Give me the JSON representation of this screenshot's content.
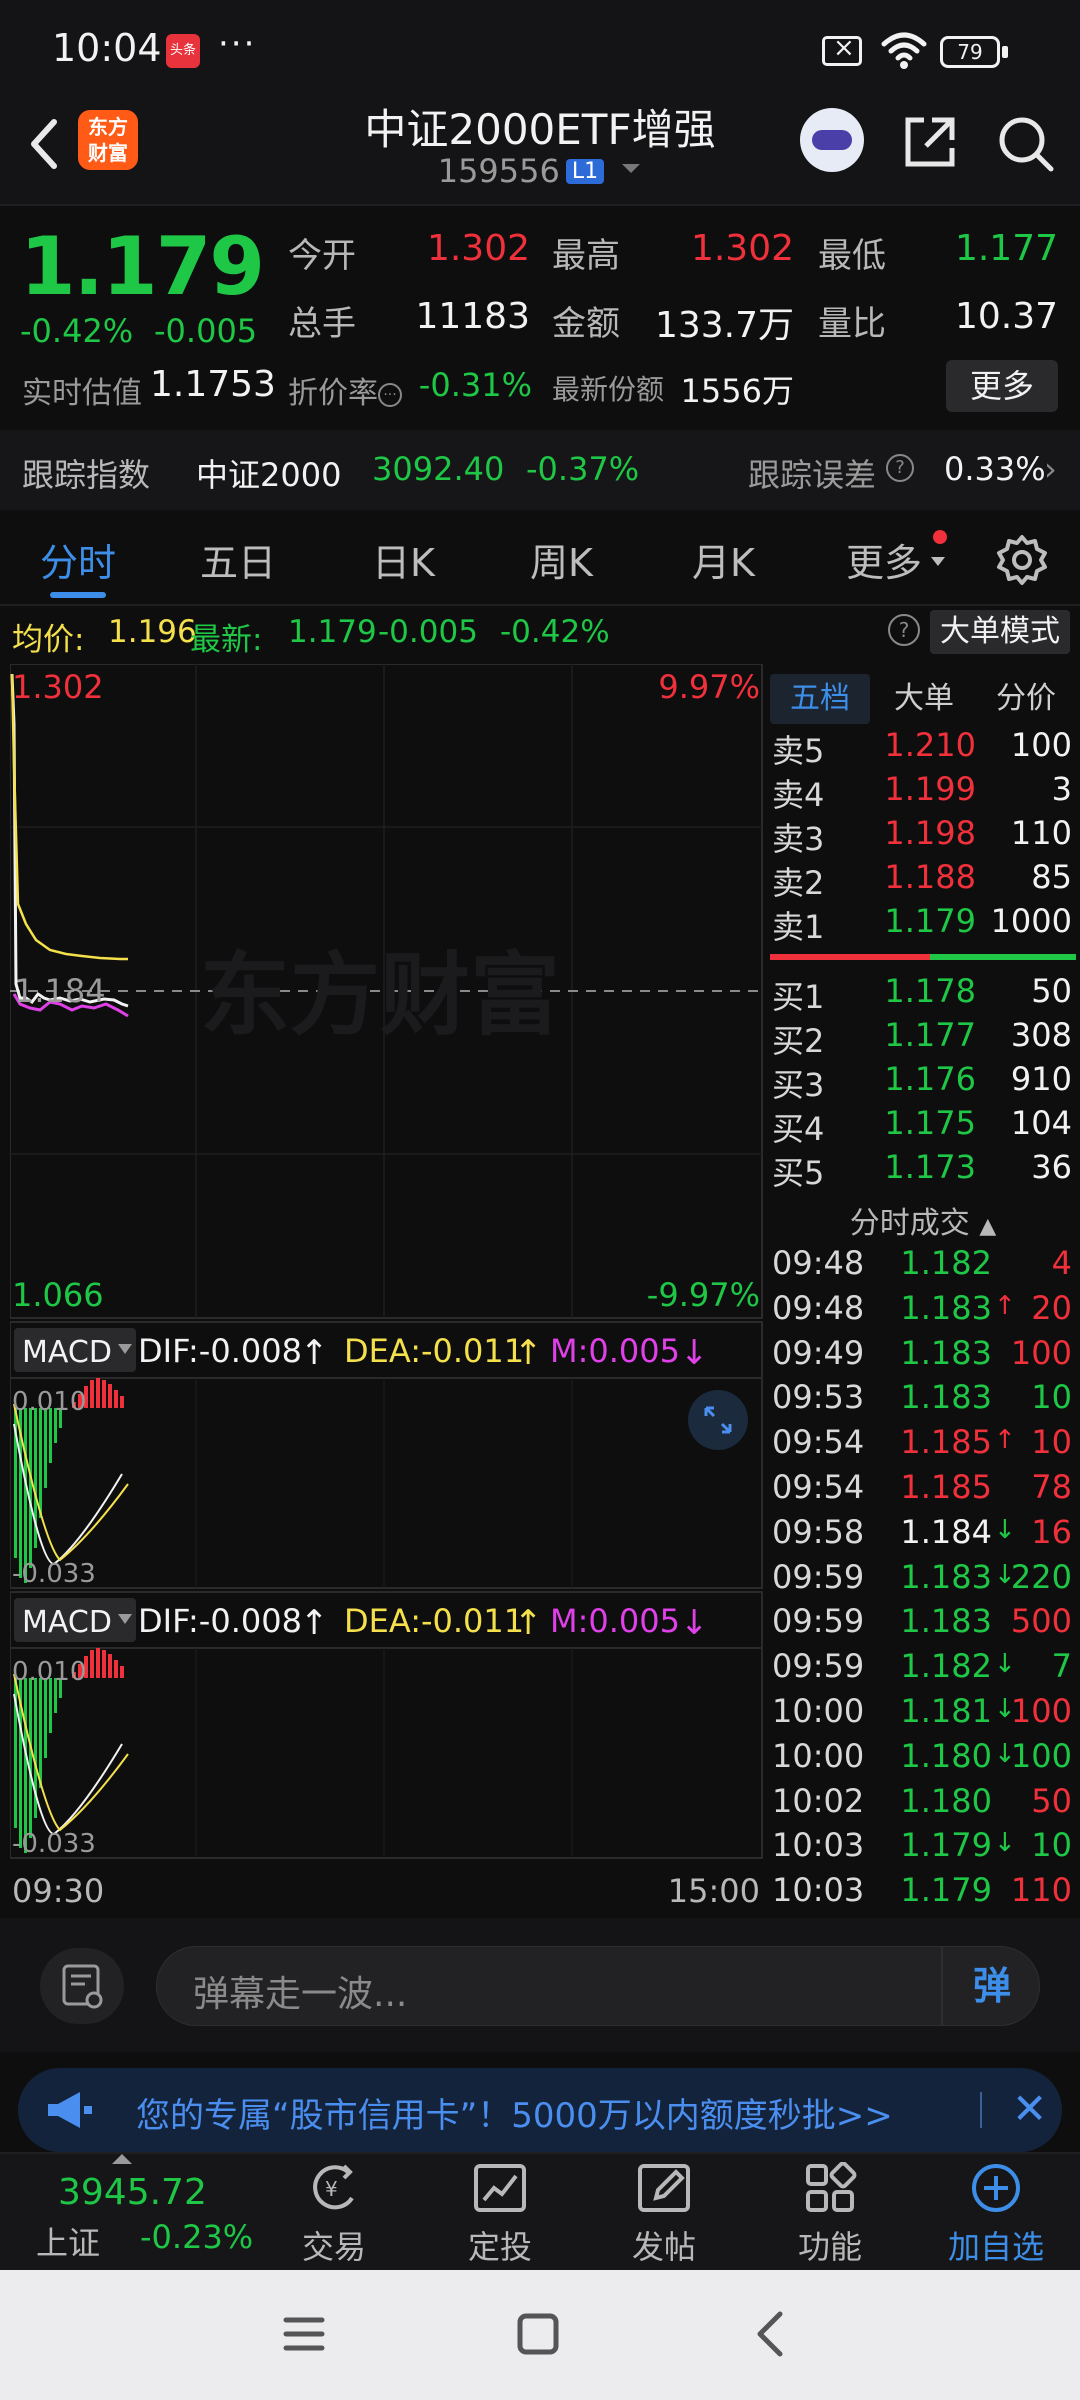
{
  "status_bar": {
    "time": "10:04",
    "notif_badge": "头条",
    "more": "···",
    "battery": "79"
  },
  "header": {
    "title": "中证2000ETF增强",
    "code": "159556",
    "level": "L1",
    "logo_line1": "东方",
    "logo_line2": "财富"
  },
  "quote": {
    "price": "1.179",
    "change_pct": "-0.42%",
    "change_val": "-0.005",
    "open_label": "今开",
    "open": "1.302",
    "high_label": "最高",
    "high": "1.302",
    "low_label": "最低",
    "low": "1.177",
    "volume_label": "总手",
    "volume": "11183",
    "amount_label": "金额",
    "amount": "133.7万",
    "vol_ratio_label": "量比",
    "vol_ratio": "10.37",
    "iopv_label": "实时估值",
    "iopv": "1.1753",
    "discount_label": "折价率",
    "discount": "-0.31%",
    "shares_label": "最新份额",
    "shares": "1556万",
    "more_label": "更多"
  },
  "tracking": {
    "label": "跟踪指数",
    "index_name": "中证2000",
    "index_value": "3092.40",
    "index_pct": "-0.37%",
    "error_label": "跟踪误差",
    "error_value": "0.33%"
  },
  "tabs": {
    "items": [
      "分时",
      "五日",
      "日K",
      "周K",
      "月K",
      "更多"
    ],
    "active": 0
  },
  "avg_row": {
    "avg_label": "均价:",
    "avg_value": "1.196",
    "last_label": "最新:",
    "last_value": "1.179",
    "last_chg": "-0.005",
    "last_pct": "-0.42%",
    "big_order": "大单模式"
  },
  "intraday": {
    "y_top": "1.302",
    "y_bottom": "1.066",
    "pct_top": "9.97%",
    "pct_bottom": "-9.97%",
    "mid": "1.184",
    "watermark": "东方财富",
    "x_start": "09:30",
    "x_end": "15:00"
  },
  "macd": {
    "name": "MACD",
    "dif": "DIF:-0.008",
    "dea": "DEA:-0.011",
    "m": "M:0.005",
    "top": "0.010",
    "bottom": "-0.033"
  },
  "orderbook": {
    "tabs": [
      "五档",
      "大单",
      "分价"
    ],
    "sells": [
      {
        "label": "卖5",
        "price": "1.210",
        "vol": "100",
        "color": "red"
      },
      {
        "label": "卖4",
        "price": "1.199",
        "vol": "3",
        "color": "red"
      },
      {
        "label": "卖3",
        "price": "1.198",
        "vol": "110",
        "color": "red"
      },
      {
        "label": "卖2",
        "price": "1.188",
        "vol": "85",
        "color": "red"
      },
      {
        "label": "卖1",
        "price": "1.179",
        "vol": "1000",
        "color": "green"
      }
    ],
    "buys": [
      {
        "label": "买1",
        "price": "1.178",
        "vol": "50",
        "color": "green"
      },
      {
        "label": "买2",
        "price": "1.177",
        "vol": "308",
        "color": "green"
      },
      {
        "label": "买3",
        "price": "1.176",
        "vol": "910",
        "color": "green"
      },
      {
        "label": "买4",
        "price": "1.175",
        "vol": "104",
        "color": "green"
      },
      {
        "label": "买5",
        "price": "1.173",
        "vol": "36",
        "color": "green"
      }
    ],
    "trades_title": "分时成交",
    "trades": [
      {
        "t": "09:48",
        "p": "1.182",
        "pc": "green",
        "ar": "",
        "v": "4",
        "vc": "red"
      },
      {
        "t": "09:48",
        "p": "1.183",
        "pc": "green",
        "ar": "↑",
        "arc": "red",
        "v": "20",
        "vc": "red"
      },
      {
        "t": "09:49",
        "p": "1.183",
        "pc": "green",
        "ar": "",
        "v": "100",
        "vc": "red"
      },
      {
        "t": "09:53",
        "p": "1.183",
        "pc": "green",
        "ar": "",
        "v": "10",
        "vc": "green"
      },
      {
        "t": "09:54",
        "p": "1.185",
        "pc": "red",
        "ar": "↑",
        "arc": "red",
        "v": "10",
        "vc": "red"
      },
      {
        "t": "09:54",
        "p": "1.185",
        "pc": "red",
        "ar": "",
        "v": "78",
        "vc": "red"
      },
      {
        "t": "09:58",
        "p": "1.184",
        "pc": "white",
        "ar": "↓",
        "arc": "green",
        "v": "16",
        "vc": "red"
      },
      {
        "t": "09:59",
        "p": "1.183",
        "pc": "green",
        "ar": "↓",
        "arc": "green",
        "v": "220",
        "vc": "green"
      },
      {
        "t": "09:59",
        "p": "1.183",
        "pc": "green",
        "ar": "",
        "v": "500",
        "vc": "red"
      },
      {
        "t": "09:59",
        "p": "1.182",
        "pc": "green",
        "ar": "↓",
        "arc": "green",
        "v": "7",
        "vc": "green"
      },
      {
        "t": "10:00",
        "p": "1.181",
        "pc": "green",
        "ar": "↓",
        "arc": "green",
        "v": "100",
        "vc": "red"
      },
      {
        "t": "10:00",
        "p": "1.180",
        "pc": "green",
        "ar": "↓",
        "arc": "green",
        "v": "100",
        "vc": "green"
      },
      {
        "t": "10:02",
        "p": "1.180",
        "pc": "green",
        "ar": "",
        "v": "50",
        "vc": "red"
      },
      {
        "t": "10:03",
        "p": "1.179",
        "pc": "green",
        "ar": "↓",
        "arc": "green",
        "v": "10",
        "vc": "green"
      },
      {
        "t": "10:03",
        "p": "1.179",
        "pc": "green",
        "ar": "",
        "v": "110",
        "vc": "red"
      }
    ]
  },
  "danmu": {
    "placeholder": "弹幕走一波...",
    "send": "弹"
  },
  "banner": {
    "text": "您的专属“股市信用卡”！5000万以内额度秒批>>"
  },
  "bottom_nav": {
    "index_value": "3945.72",
    "index_name": "上证",
    "index_pct": "-0.23%",
    "items": [
      "交易",
      "定投",
      "发帖",
      "功能",
      "加自选"
    ]
  },
  "colors": {
    "up": "#f0303a",
    "down": "#1fc746",
    "accent": "#3d8ee8",
    "avg": "#f4e04b"
  }
}
